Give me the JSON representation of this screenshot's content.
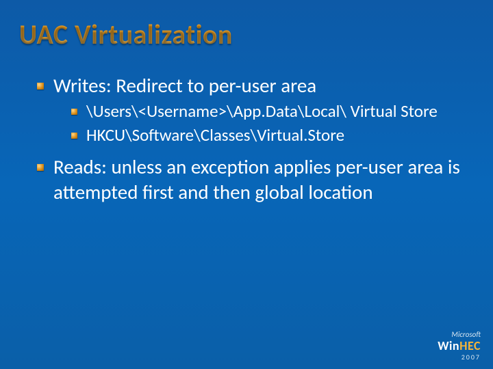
{
  "title": "UAC Virtualization",
  "bullets": [
    {
      "text": "Writes:  Redirect to per-user area",
      "children": [
        "\\Users\\<Username>\\App.Data\\Local\\ Virtual Store",
        "HKCU\\Software\\Classes\\Virtual.Store"
      ]
    },
    {
      "text": "Reads: unless an exception applies per-user area is attempted first and then global location",
      "children": []
    }
  ],
  "footer": {
    "brand": "Microsoft",
    "conf_pre": "Win",
    "conf_accent": "HEC",
    "year": "2007"
  }
}
